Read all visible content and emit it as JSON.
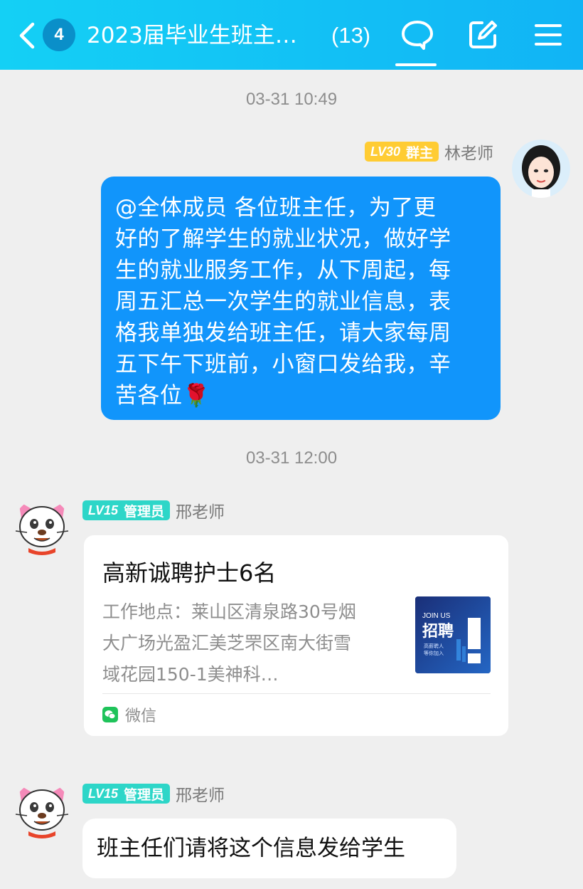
{
  "header": {
    "unread_count": "4",
    "title": "2023届毕业生班主…",
    "member_count": "(13)",
    "accent_color": "#14c5f5"
  },
  "messages": [
    {
      "timestamp": "03-31 10:49",
      "sender": {
        "level": "LV30",
        "role": "群主",
        "name": "林老师"
      },
      "lines": [
        "@全体成员 各位班主任，为了更",
        "好的了解学生的就业状况，做好学",
        "生的就业服务工作，从下周起，每",
        "周五汇总一次学生的就业信息，表",
        "格我单独发给班主任，请大家每周",
        "五下午下班前，小窗口发给我，辛",
        "苦各位🌹"
      ]
    },
    {
      "timestamp": "03-31 12:00",
      "sender": {
        "level": "LV15",
        "role": "管理员",
        "name": "邢老师"
      },
      "card": {
        "title": "高新诚聘护士6名",
        "desc_lines": [
          "工作地点：莱山区清泉路30号烟",
          "大广场光盈汇美芝罘区南大街雪",
          "域花园150-1美神科…"
        ],
        "thumb": {
          "line1": "JOIN US",
          "line2": "招聘",
          "line3": "高薪聘人",
          "line4": "等你加入"
        },
        "source": "微信"
      }
    },
    {
      "sender": {
        "level": "LV15",
        "role": "管理员",
        "name": "邢老师"
      },
      "text": "班主任们请将这个信息发给学生"
    }
  ]
}
